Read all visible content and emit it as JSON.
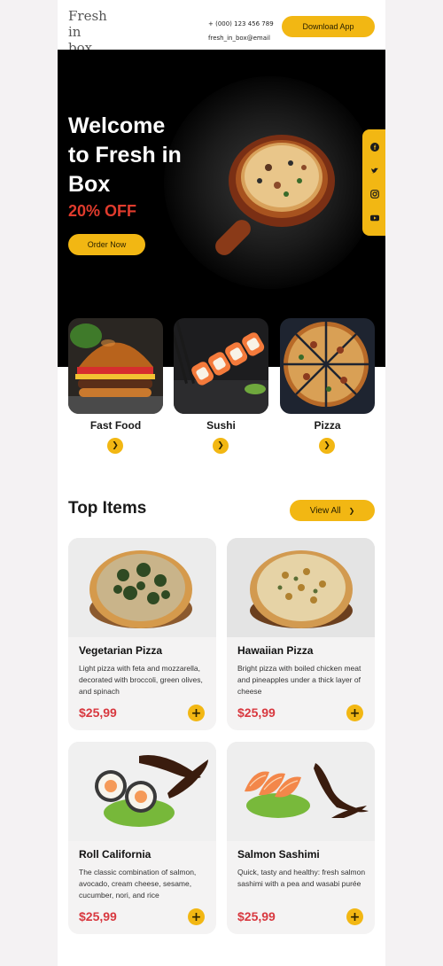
{
  "header": {
    "logo": "Fresh in box.",
    "phone": "+ (000) 123 456 789",
    "email": "fresh_in_box@email",
    "download_label": "Download App"
  },
  "hero": {
    "title": "Welcome to Fresh in Box",
    "discount": "20% OFF",
    "order_label": "Order Now"
  },
  "social": [
    "facebook-icon",
    "twitter-icon",
    "instagram-icon",
    "youtube-icon"
  ],
  "categories": [
    {
      "label": "Fast Food"
    },
    {
      "label": "Sushi"
    },
    {
      "label": "Pizza"
    }
  ],
  "top_items": {
    "title": "Top Items",
    "view_all_label": "View All",
    "items": [
      {
        "name": "Vegetarian Pizza",
        "desc": "Light pizza with feta and mozzarella, decorated with broccoli, green olives, and spinach",
        "price": "$25,99"
      },
      {
        "name": "Hawaiian Pizza",
        "desc": "Bright pizza with boiled chicken meat and pineapples under a thick layer of cheese",
        "price": "$25,99"
      },
      {
        "name": "Roll California",
        "desc": "The classic combination of salmon, avocado, cream cheese, sesame, cucumber, nori, and rice",
        "price": "$25,99"
      },
      {
        "name": "Salmon Sashimi",
        "desc": "Quick, tasty and healthy: fresh salmon sashimi with a pea and wasabi purée",
        "price": "$25,99"
      }
    ]
  },
  "colors": {
    "accent": "#f2b713",
    "price": "#d8383f",
    "discount": "#e03b2d"
  }
}
